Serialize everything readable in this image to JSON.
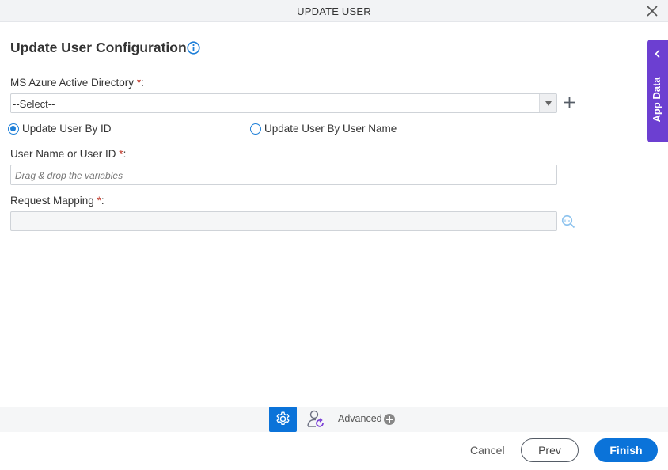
{
  "header": {
    "title": "UPDATE USER",
    "close_icon": "close-icon"
  },
  "page": {
    "title": "Update User Configuration",
    "info_icon": "info-icon"
  },
  "form": {
    "directory": {
      "label": "MS Azure Active Directory",
      "required_mark": "*",
      "suffix": ":",
      "value": "--Select--",
      "add_icon": "plus-icon"
    },
    "update_mode": {
      "options": [
        {
          "label": "Update User By ID",
          "checked": true
        },
        {
          "label": "Update User By User Name",
          "checked": false
        }
      ]
    },
    "user_id": {
      "label": "User Name or User ID",
      "required_mark": "*",
      "suffix": ":",
      "placeholder": "Drag & drop the variables",
      "value": ""
    },
    "request_mapping": {
      "label": "Request Mapping",
      "required_mark": "*",
      "suffix": ":",
      "value": "",
      "mapping_icon": "mapping-search-icon"
    }
  },
  "side_panel": {
    "label": "App Data",
    "icon": "chevron-left-icon",
    "color": "#6c3fd1"
  },
  "footer_tabs": {
    "settings_icon": "gear-icon",
    "user_icon": "user-refresh-icon",
    "advanced_label": "Advanced",
    "advanced_icon": "plus-circle-icon"
  },
  "actions": {
    "cancel": "Cancel",
    "prev": "Prev",
    "finish": "Finish"
  },
  "colors": {
    "primary": "#0b73d9",
    "accent_panel": "#6c3fd1",
    "required": "#c0392b"
  }
}
